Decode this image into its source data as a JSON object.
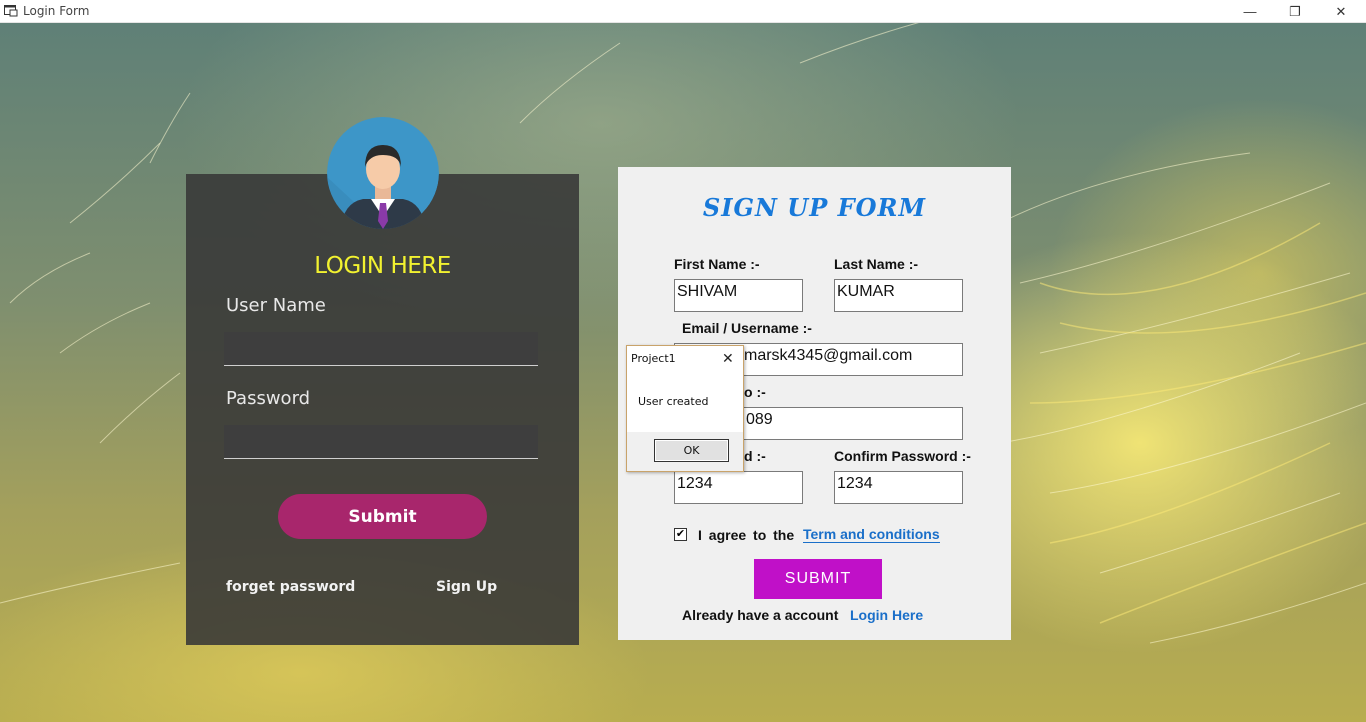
{
  "window": {
    "title": "Login Form",
    "minimize": "—",
    "maximize": "❐",
    "close": "✕"
  },
  "login": {
    "title": "LOGIN HERE",
    "username_label": "User Name",
    "username_value": "",
    "password_label": "Password",
    "password_value": "",
    "submit": "Submit",
    "forget": "forget password",
    "signup": "Sign Up"
  },
  "signup": {
    "title": "SIGN UP FORM",
    "first_name_label": "First Name :-",
    "first_name_value": "SHIVAM",
    "last_name_label": "Last Name :-",
    "last_name_value": "KUMAR",
    "email_label": "Email / Username :-",
    "email_value": "marsk4345@gmail.com",
    "mobile_label": "o :-",
    "mobile_value": "089",
    "password_label": "d :-",
    "password_value": "1234",
    "confirm_label": "Confirm Password :-",
    "confirm_value": "1234",
    "checkbox_checked": true,
    "checkbox_mark": "✔",
    "agree": "I agree to the",
    "terms": "Term and conditions",
    "submit": "SUBMIT",
    "already": "Already have a account",
    "login_here": "Login Here"
  },
  "messagebox": {
    "title": "Project1",
    "close": "✕",
    "text": "User created",
    "ok": "OK"
  }
}
